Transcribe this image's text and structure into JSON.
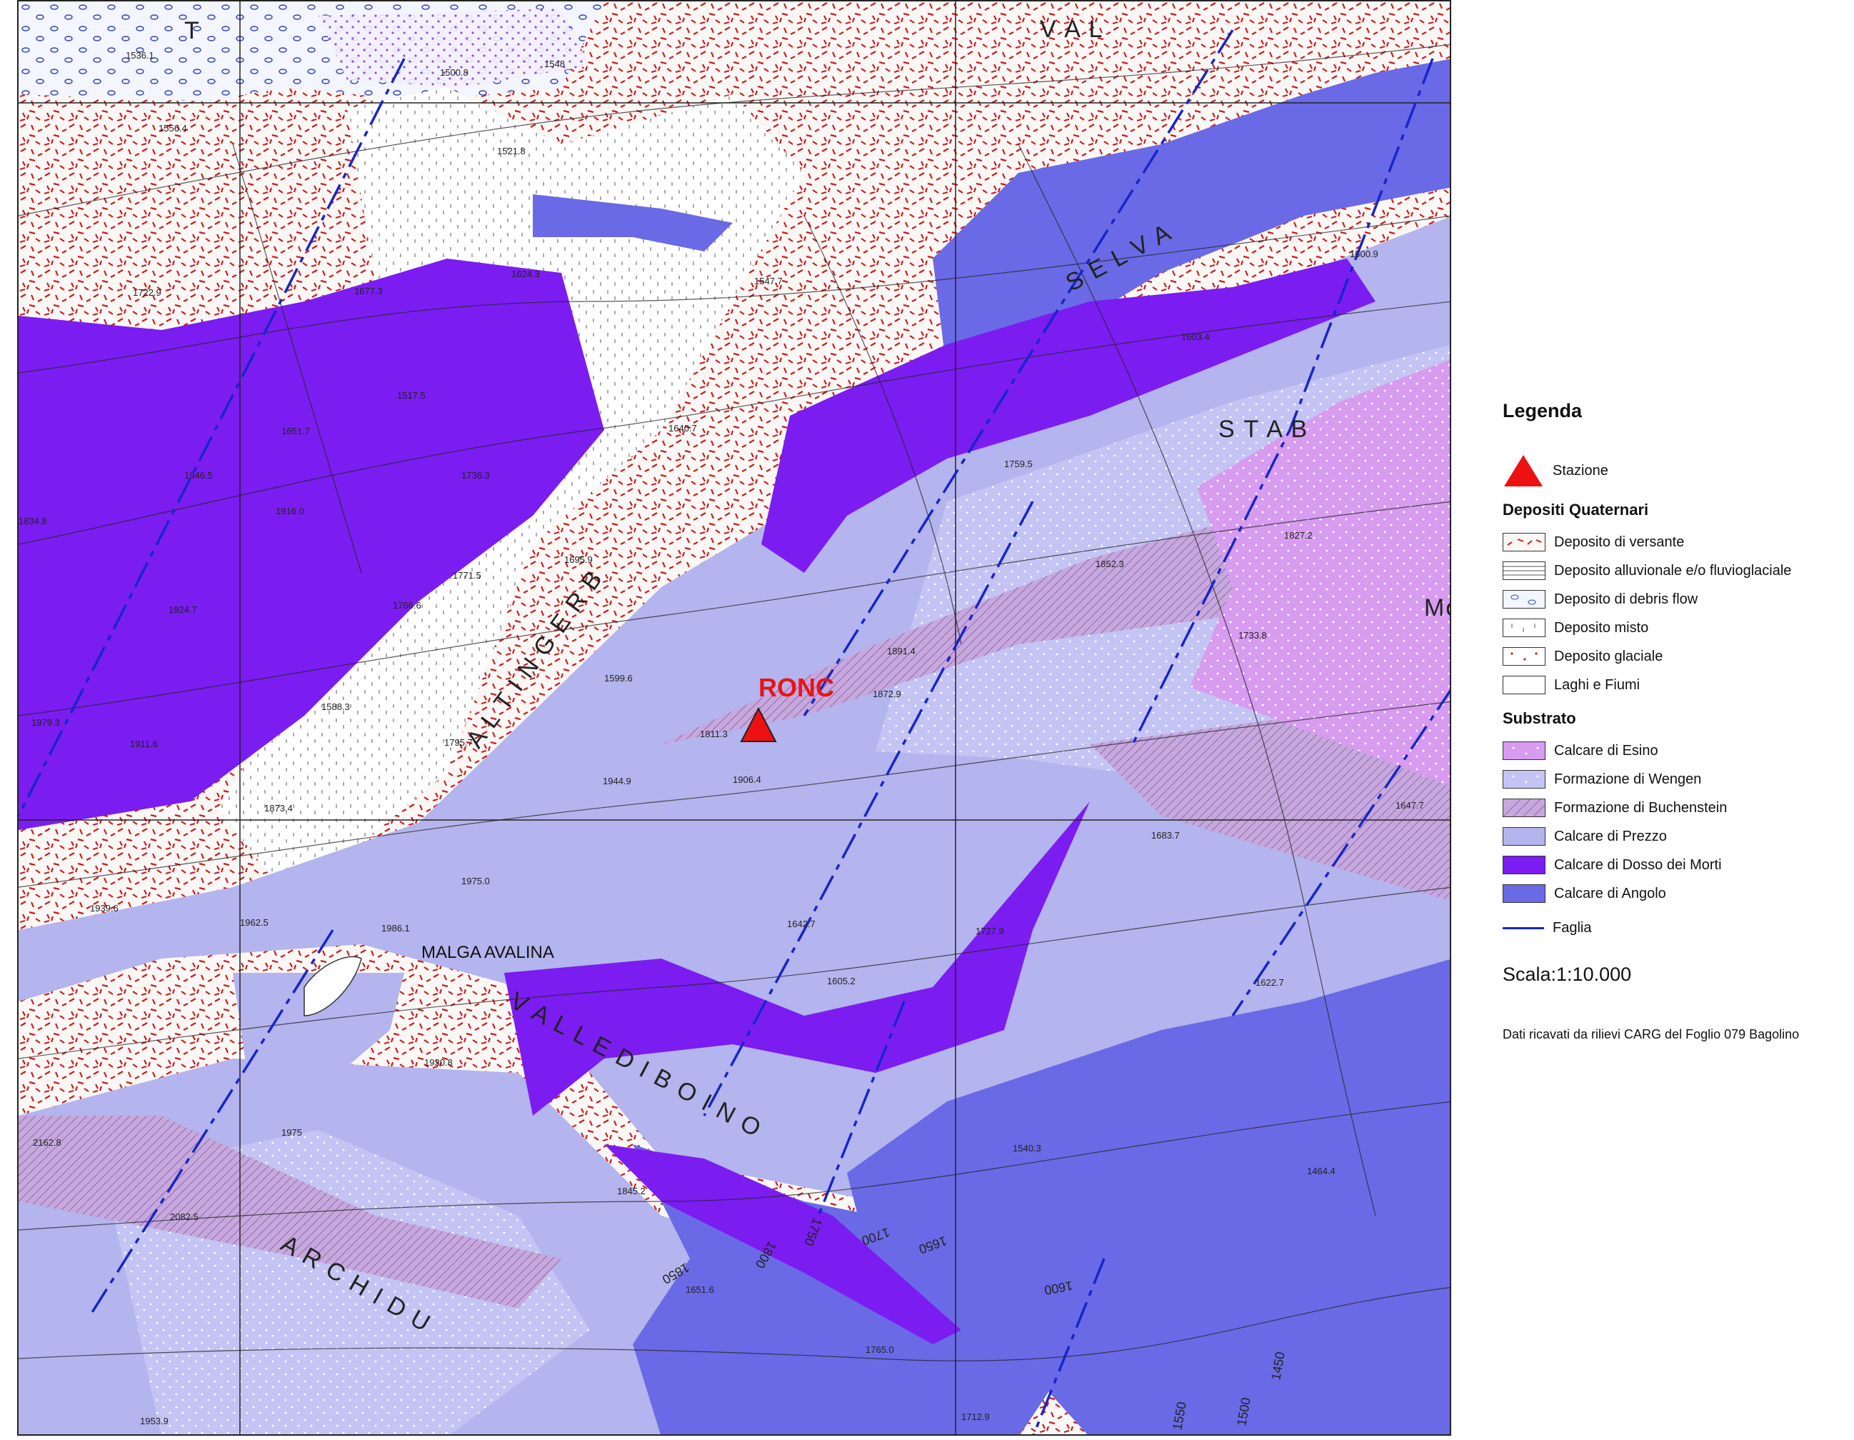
{
  "map": {
    "elevations": [
      "1536.1",
      "1500.8",
      "1548",
      "1556.4",
      "1521.8",
      "1722.9",
      "1677.3",
      "1624.3",
      "1547.7",
      "1517.5",
      "1651.7",
      "1640.7",
      "1946.5",
      "1916.0",
      "1736.3",
      "1834.8",
      "1771.5",
      "1695.9",
      "1924.7",
      "1766.6",
      "1599.6",
      "1979.3",
      "1911.6",
      "1588.3",
      "1795.7",
      "1811.3",
      "1944.9",
      "1906.4",
      "1873.4",
      "1891.4",
      "1872.9",
      "1759.5",
      "1852.3",
      "1827.2",
      "1733.8",
      "1603.4",
      "1500.9",
      "1975.0",
      "1939.6",
      "1962.5",
      "1986.1",
      "1642.7",
      "1683.7",
      "1647.7",
      "1727.9",
      "1605.2",
      "1930.8",
      "1622.7",
      "1975",
      "2162.8",
      "2082.5",
      "1845.2",
      "1651.6",
      "1540.3",
      "1464.4",
      "1765.0",
      "1953.9",
      "1712.9"
    ],
    "contour_labels": [
      "1850",
      "1800",
      "1750",
      "1700",
      "1650",
      "1600",
      "1550",
      "1500",
      "1450",
      "1550"
    ],
    "valley_names": {
      "val": "V  A  L",
      "selva": "S  E  L  V  A",
      "valle_di_boino": "V  A  L  L  E    D  I    B  O  I  N  O",
      "archidu": "A  R  C  H  I  D  U",
      "stab": "S  T  A  B",
      "ronc_valley": "A  L  T  I  N  G  E  R  B",
      "ta": "T"
    },
    "station_name": "RONC",
    "place_name": "MALGA AVALINA",
    "partial_label_mo": "Mo"
  },
  "legend": {
    "title": "Legenda",
    "station": "Stazione",
    "quaternary_title": "Depositi Quaternari",
    "quaternary": [
      {
        "label": "Deposito di versante",
        "color": "#fbf7f5",
        "icon": "red-dash-pattern"
      },
      {
        "label": "Deposito alluvionale e/o fluvioglaciale",
        "color": "#ffffff",
        "icon": "horizontal-lines-pattern"
      },
      {
        "label": "Deposito di debris flow",
        "color": "#f4f6ff",
        "icon": "blue-ellipse-pattern"
      },
      {
        "label": "Deposito misto",
        "color": "#ffffff",
        "icon": "tick-pattern"
      },
      {
        "label": "Deposito glaciale",
        "color": "#ffffff",
        "icon": "dot-pattern"
      },
      {
        "label": "Laghi e Fiumi",
        "color": "#ffffff",
        "icon": "plain"
      }
    ],
    "bedrock_title": "Substrato",
    "bedrock": [
      {
        "label": "Calcare di Esino",
        "color": "#d79bf0"
      },
      {
        "label": "Formazione di Wengen",
        "color": "#c4c4f4"
      },
      {
        "label": "Formazione di Buchenstein",
        "color": "#c7a8dd"
      },
      {
        "label": "Calcare di Prezzo",
        "color": "#b4b4ee"
      },
      {
        "label": "Calcare di Dosso dei Morti",
        "color": "#7b1df0"
      },
      {
        "label": "Calcare di Angolo",
        "color": "#6a6ae6"
      }
    ],
    "fault": "Faglia",
    "fault_color": "#1726c8",
    "station_color": "#ee1111",
    "scale": "Scala:1:10.000",
    "source": "Dati ricavati da rilievi CARG del Foglio 079 Bagolino"
  }
}
